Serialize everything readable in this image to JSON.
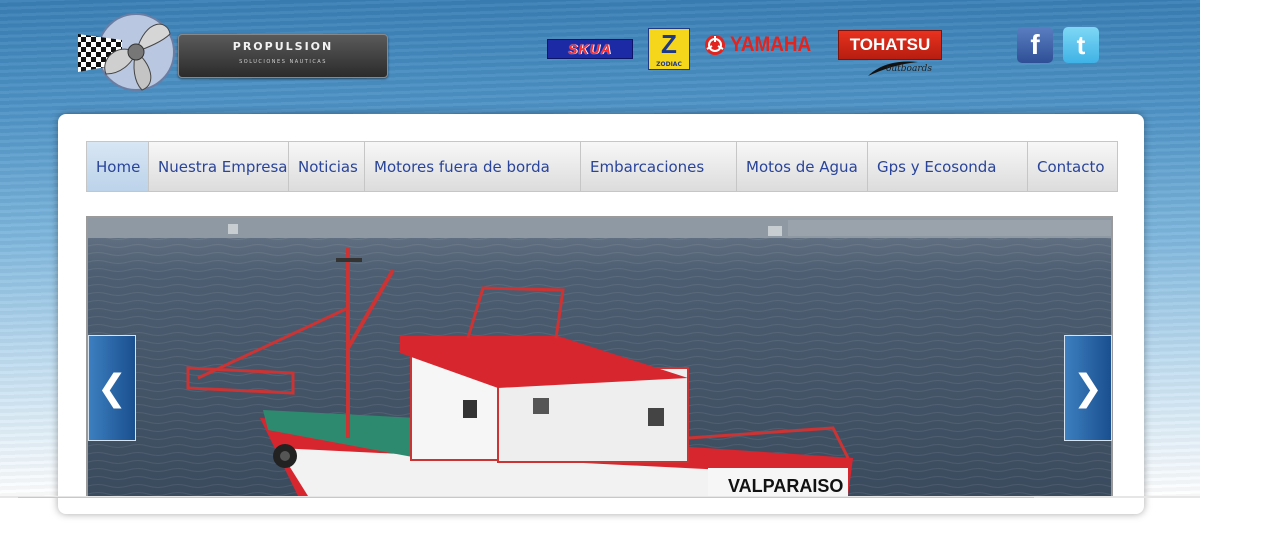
{
  "header": {
    "logo": {
      "title": "PROPULSION",
      "subtitle": "SOLUCIONES NAUTICAS"
    },
    "brands": {
      "skua": "SKUA",
      "zodiac_mark": "Z",
      "zodiac_text": "ZODIAC",
      "yamaha": "YAMAHA",
      "tohatsu": "TOHATSU",
      "tohatsu_sub": "outboards"
    },
    "social": {
      "facebook_glyph": "f",
      "twitter_glyph": "t"
    }
  },
  "nav": {
    "items": [
      {
        "label": "Home",
        "active": true
      },
      {
        "label": "Nuestra Empresa",
        "active": false
      },
      {
        "label": "Noticias",
        "active": false
      },
      {
        "label": "Motores fuera de borda",
        "active": false
      },
      {
        "label": "Embarcaciones",
        "active": false
      },
      {
        "label": "Motos de Agua",
        "active": false
      },
      {
        "label": "Gps y Ecosonda",
        "active": false
      },
      {
        "label": "Contacto",
        "active": false
      }
    ]
  },
  "slider": {
    "boat_name": "VALPARAISO",
    "prev_glyph": "❮",
    "next_glyph": "❯"
  },
  "colors": {
    "nav_text": "#29449a",
    "arrow_bg": "#1a4f8f",
    "boat_red": "#d8262f"
  }
}
